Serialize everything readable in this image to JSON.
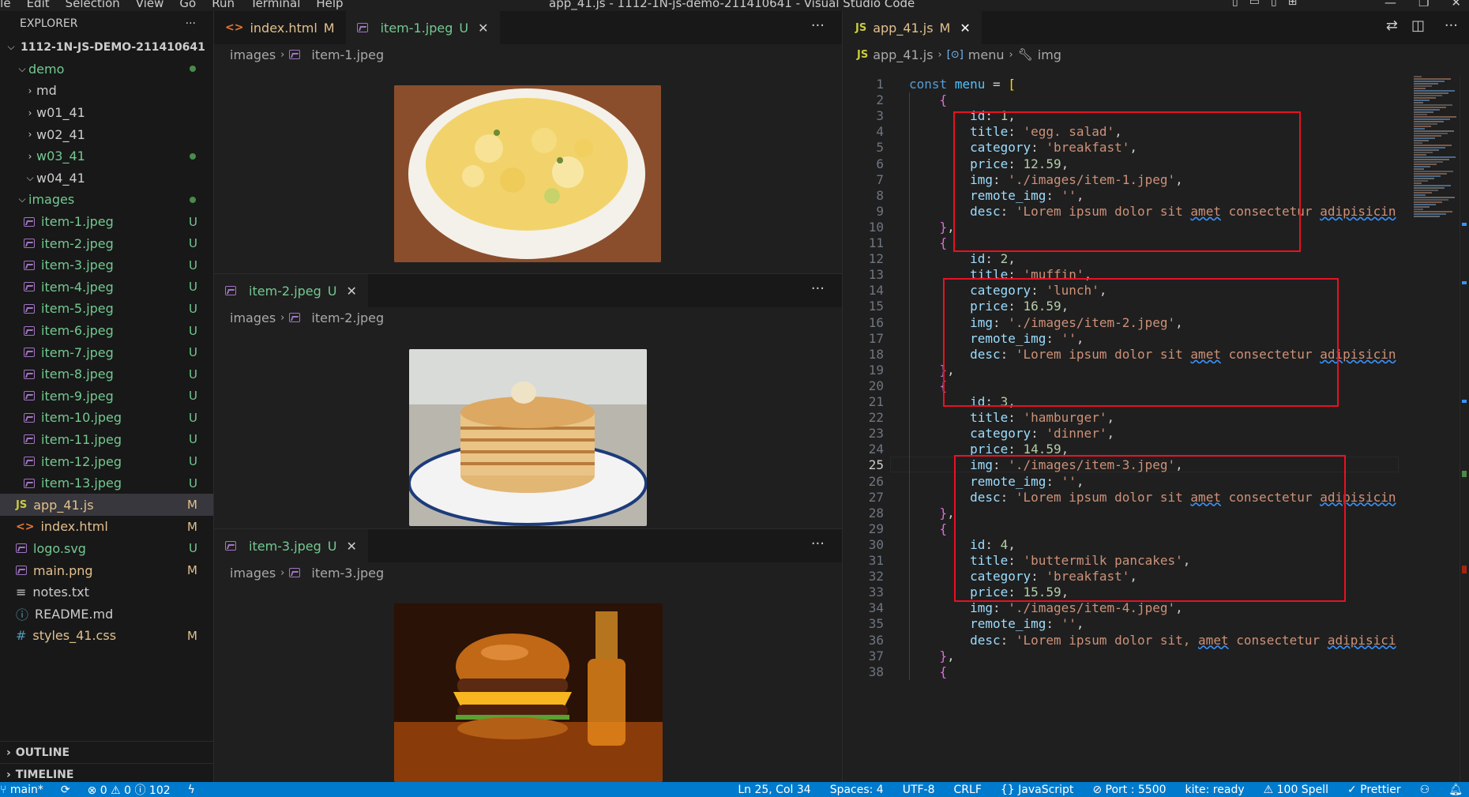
{
  "titlebar": {
    "menu": [
      "ile",
      "Edit",
      "Selection",
      "View",
      "Go",
      "Run",
      "Terminal",
      "Help"
    ],
    "title": "app_41.js - 1112-1N-js-demo-211410641 - Visual Studio Code"
  },
  "explorer": {
    "header": "EXPLORER",
    "root": "1112-1N-JS-DEMO-211410641",
    "items": [
      {
        "label": "demo",
        "type": "folder-open",
        "level": 1,
        "status": "dot"
      },
      {
        "label": "md",
        "type": "folder",
        "level": 2
      },
      {
        "label": "w01_41",
        "type": "folder",
        "level": 2
      },
      {
        "label": "w02_41",
        "type": "folder",
        "level": 2
      },
      {
        "label": "w03_41",
        "type": "folder",
        "level": 2,
        "status": "dot"
      },
      {
        "label": "w04_41",
        "type": "folder-open",
        "level": 2
      },
      {
        "label": "images",
        "type": "folder-open",
        "level": 1,
        "status": "dot"
      },
      {
        "label": "item-1.jpeg",
        "type": "image",
        "level": 2,
        "badge": "U"
      },
      {
        "label": "item-2.jpeg",
        "type": "image",
        "level": 2,
        "badge": "U"
      },
      {
        "label": "item-3.jpeg",
        "type": "image",
        "level": 2,
        "badge": "U"
      },
      {
        "label": "item-4.jpeg",
        "type": "image",
        "level": 2,
        "badge": "U"
      },
      {
        "label": "item-5.jpeg",
        "type": "image",
        "level": 2,
        "badge": "U"
      },
      {
        "label": "item-6.jpeg",
        "type": "image",
        "level": 2,
        "badge": "U"
      },
      {
        "label": "item-7.jpeg",
        "type": "image",
        "level": 2,
        "badge": "U"
      },
      {
        "label": "item-8.jpeg",
        "type": "image",
        "level": 2,
        "badge": "U"
      },
      {
        "label": "item-9.jpeg",
        "type": "image",
        "level": 2,
        "badge": "U"
      },
      {
        "label": "item-10.jpeg",
        "type": "image",
        "level": 2,
        "badge": "U"
      },
      {
        "label": "item-11.jpeg",
        "type": "image",
        "level": 2,
        "badge": "U"
      },
      {
        "label": "item-12.jpeg",
        "type": "image",
        "level": 2,
        "badge": "U"
      },
      {
        "label": "item-13.jpeg",
        "type": "image",
        "level": 2,
        "badge": "U"
      },
      {
        "label": "app_41.js",
        "type": "js",
        "level": 1,
        "badge": "M",
        "active": true
      },
      {
        "label": "index.html",
        "type": "html",
        "level": 1,
        "badge": "M"
      },
      {
        "label": "logo.svg",
        "type": "image",
        "level": 1,
        "badge": "U"
      },
      {
        "label": "main.png",
        "type": "image",
        "level": 1,
        "badge": "M"
      },
      {
        "label": "notes.txt",
        "type": "text",
        "level": 1
      },
      {
        "label": "README.md",
        "type": "info",
        "level": 1
      },
      {
        "label": "styles_41.css",
        "type": "css",
        "level": 1,
        "badge": "M"
      }
    ],
    "outline": "OUTLINE",
    "timeline": "TIMELINE"
  },
  "middle": {
    "pane1": {
      "tabs": [
        {
          "label": "index.html",
          "badge": "M"
        },
        {
          "label": "item-1.jpeg",
          "badge": "U"
        }
      ],
      "crumb": [
        "images",
        "item-1.jpeg"
      ]
    },
    "pane2": {
      "tab": "item-2.jpeg",
      "badge": "U",
      "crumb": [
        "images",
        "item-2.jpeg"
      ]
    },
    "pane3": {
      "tab": "item-3.jpeg",
      "badge": "U",
      "crumb": [
        "images",
        "item-3.jpeg"
      ]
    },
    "more": "···"
  },
  "editor": {
    "tab": "app_41.js",
    "tab_badge": "M",
    "crumb": [
      "app_41.js",
      "menu",
      "img"
    ],
    "current_line": 25,
    "line_numbers": [
      "1",
      "2",
      "3",
      "4",
      "5",
      "6",
      "7",
      "8",
      "9",
      "10",
      "11",
      "12",
      "13",
      "14",
      "15",
      "16",
      "17",
      "18",
      "19",
      "20",
      "21",
      "22",
      "23",
      "24",
      "25",
      "26",
      "27",
      "28",
      "29",
      "30",
      "31",
      "32",
      "33",
      "34",
      "35",
      "36",
      "37",
      "38"
    ],
    "items": [
      {
        "id": "1",
        "title": "'egg. salad'",
        "category": "'breakfast'",
        "price": "12.59",
        "img": "'./images/item-1.jpeg'",
        "desc": "'Lorem ipsum dolor sit amet consectetur adipisicin"
      },
      {
        "id": "2",
        "title": "'muffin'",
        "category": "'lunch'",
        "price": "16.59",
        "img": "'./images/item-2.jpeg'",
        "desc": "'Lorem ipsum dolor sit amet consectetur adipisicin"
      },
      {
        "id": "3",
        "title": "'hamburger'",
        "category": "'dinner'",
        "price": "14.59",
        "img": "'./images/item-3.jpeg'",
        "desc": "'Lorem ipsum dolor sit amet consectetur adipisicin"
      },
      {
        "id": "4",
        "title": "'buttermilk pancakes'",
        "category": "'breakfast'",
        "price": "15.59",
        "img": "'./images/item-4.jpeg'",
        "desc": "'Lorem ipsum dolor sit, amet consectetur adipisici"
      }
    ],
    "remote_img": "''"
  },
  "statusbar": {
    "branch": "main*",
    "problems": "⊗ 0 ⚠ 0 ⓘ 102",
    "position": "Ln 25, Col 34",
    "spaces": "Spaces: 4",
    "encoding": "UTF-8",
    "eol": "CRLF",
    "language": "{} JavaScript",
    "port": "⊘ Port : 5500",
    "kite": "kite: ready",
    "spell": "⚠ 100 Spell",
    "prettier": "✓ Prettier"
  }
}
